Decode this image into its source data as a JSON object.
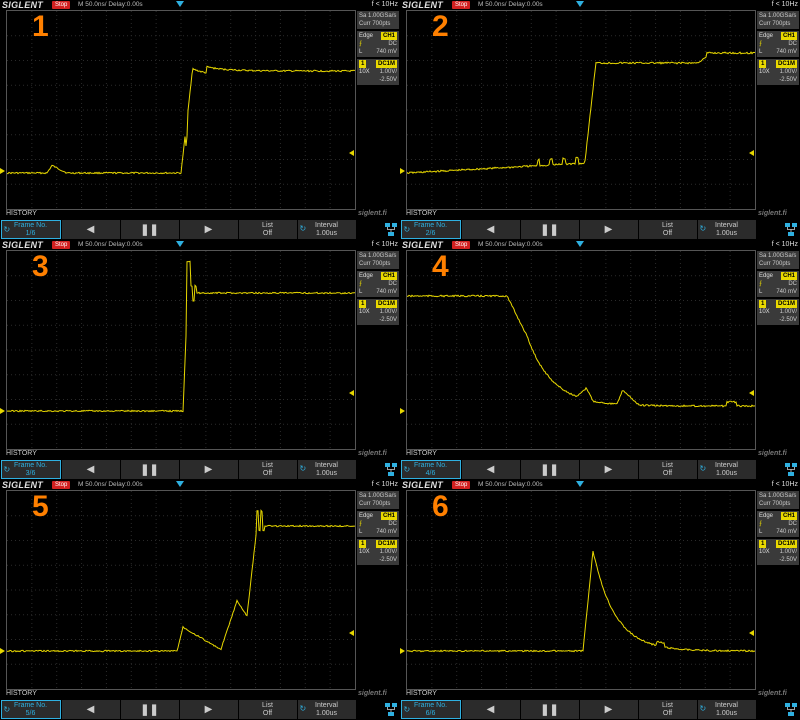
{
  "scope": {
    "brand": "SIGLENT",
    "state": "Stop",
    "timebase": "M 50.0ns/",
    "delay": "Delay:0.00s",
    "freq": "f < 10Hz",
    "sample_rate": "Sa 1.00GSa/s",
    "curr_pts": "Curr 700pts",
    "trig_label": "Edge",
    "trig_channel": "CH1",
    "trig_slope_icon": "rising-edge-icon",
    "coupling": "DC",
    "level_label": "L",
    "level": "740 mV",
    "ch_num": "1",
    "ch_coupling": "DC1M",
    "probe": "10X",
    "volts_div": "1.00V/",
    "offset": "-2.50V",
    "history_label": "HISTORY",
    "watermark": "siglent.fi",
    "frame_label": "Frame No.",
    "list_label": "List",
    "list_value": "Off",
    "interval_label": "Interval",
    "interval_value": "1.00us",
    "accent": "#2fb0e0",
    "trace_color": "#e8d800",
    "number_color": "#ff8000"
  },
  "panels": [
    {
      "num": "1",
      "frame": "1/6",
      "list_active": true
    },
    {
      "num": "2",
      "frame": "2/6",
      "list_active": false
    },
    {
      "num": "3",
      "frame": "3/6",
      "list_active": false
    },
    {
      "num": "4",
      "frame": "4/6",
      "list_active": false
    },
    {
      "num": "5",
      "frame": "5/6",
      "list_active": false
    },
    {
      "num": "6",
      "frame": "6/6",
      "list_active": false
    }
  ]
}
